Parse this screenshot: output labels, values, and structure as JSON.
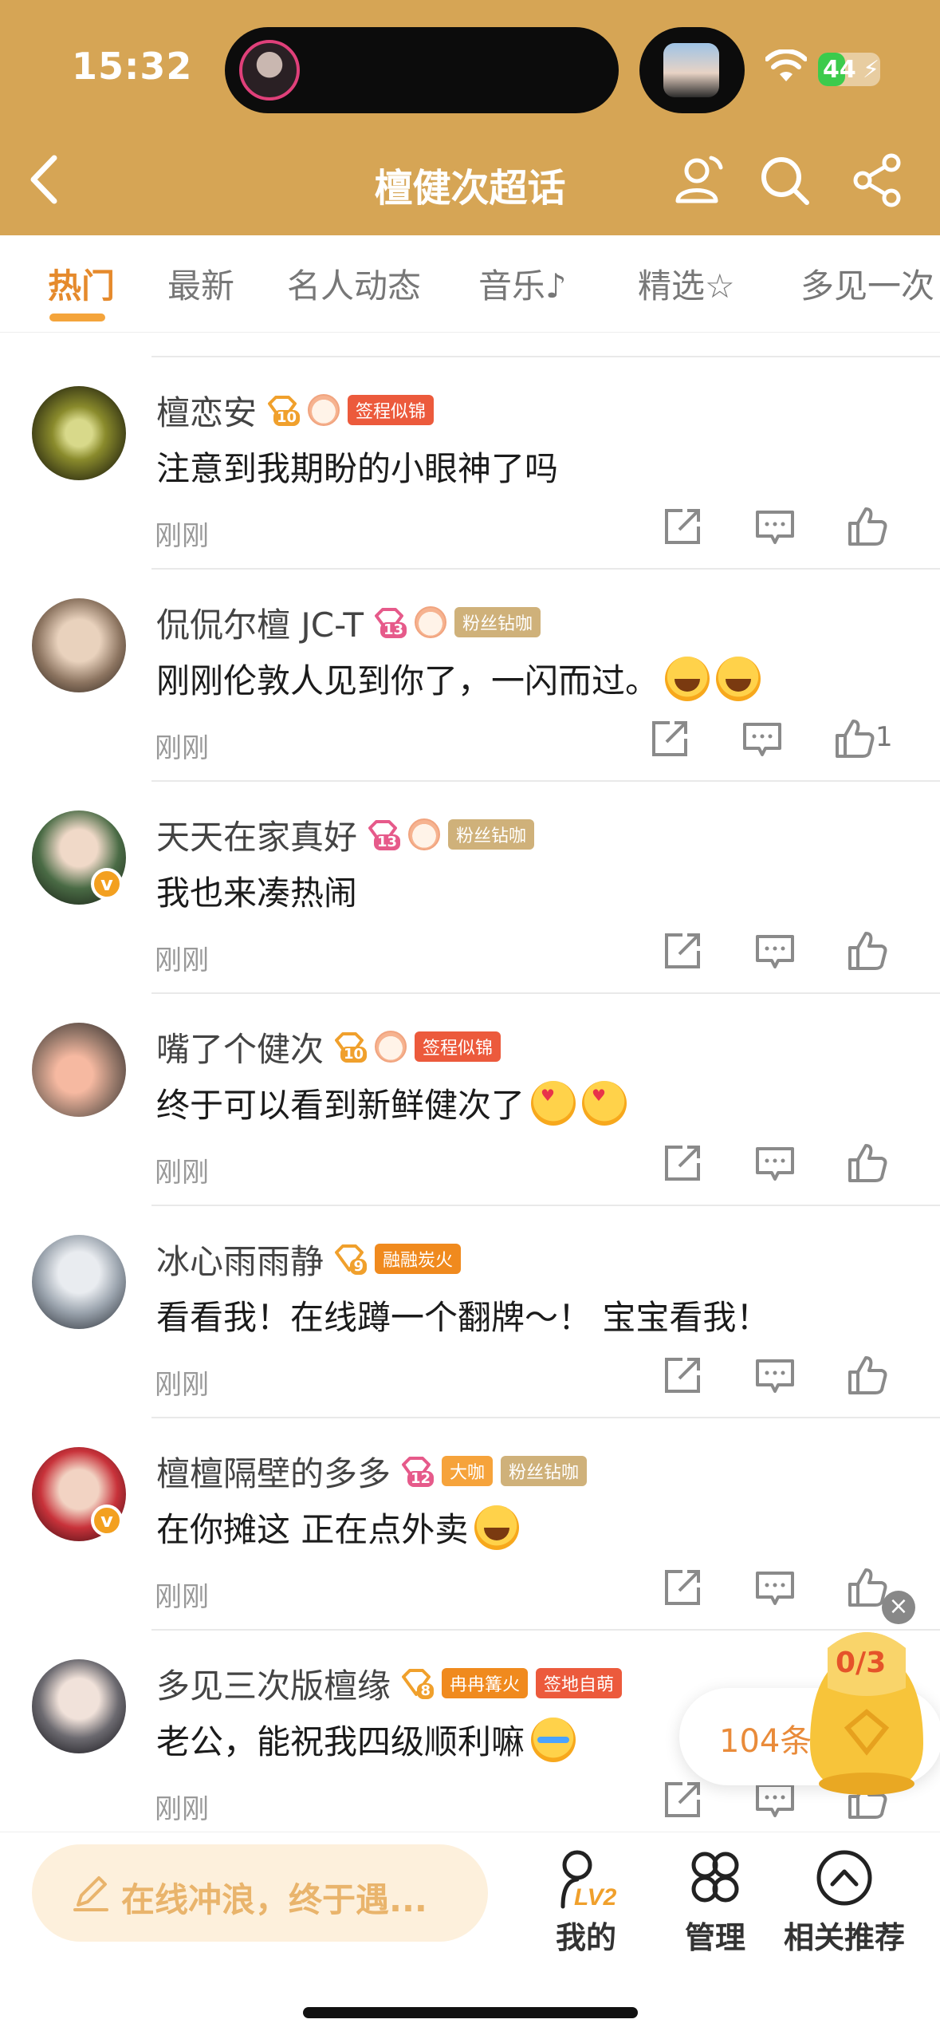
{
  "status_bar": {
    "time": "15:32",
    "battery": "44",
    "battery_level": 0.44
  },
  "header": {
    "title": "檀健次超话"
  },
  "tabs": [
    {
      "label": "热门",
      "active": true
    },
    {
      "label": "最新"
    },
    {
      "label": "名人动态"
    },
    {
      "label": "音乐"
    },
    {
      "label": "精选"
    },
    {
      "label": "多见一次"
    }
  ],
  "comments": [
    {
      "user": "檀恋安",
      "level": "10",
      "tags": [
        "签程似锦"
      ],
      "text": "注意到我期盼的小眼神了吗",
      "time": "刚刚",
      "likes": ""
    },
    {
      "user": "侃侃尔檀 JC-T",
      "level": "13",
      "tags": [
        "粉丝钻咖"
      ],
      "text": "刚刚伦敦人见到你了，一闪而过。",
      "time": "刚刚",
      "likes": "1"
    },
    {
      "user": "天天在家真好",
      "level": "13",
      "tags": [
        "粉丝钻咖"
      ],
      "text": "我也来凑热闹",
      "time": "刚刚",
      "likes": ""
    },
    {
      "user": "嘴了个健次",
      "level": "10",
      "tags": [
        "签程似锦"
      ],
      "text": "终于可以看到新鲜健次了",
      "time": "刚刚",
      "likes": ""
    },
    {
      "user": "冰心雨雨静",
      "level": "9",
      "tags": [
        "融融炭火"
      ],
      "text": "看看我！在线蹲一个翻牌～！ 宝宝看我！",
      "time": "刚刚",
      "likes": ""
    },
    {
      "user": "檀檀隔壁的多多",
      "level": "12",
      "tags": [
        "大咖",
        "粉丝钻咖"
      ],
      "text": "在你摊这 正在点外卖",
      "time": "刚刚",
      "likes": ""
    },
    {
      "user": "多见三次版檀缘",
      "level": "8",
      "tags": [
        "冉冉篝火",
        "签地自萌"
      ],
      "text": "老公，能祝我四级顺利嘛",
      "time": "刚刚",
      "likes": ""
    }
  ],
  "reward": {
    "progress": "0/3",
    "count": "104条"
  },
  "bottom": {
    "compose_placeholder": "在线冲浪，终于遇...",
    "level_badge": "LV2",
    "nav": [
      "我的",
      "管理",
      "相关推荐"
    ]
  },
  "colors": {
    "brand_gold": "#d6a555",
    "tab_active": "#e58a2c"
  }
}
